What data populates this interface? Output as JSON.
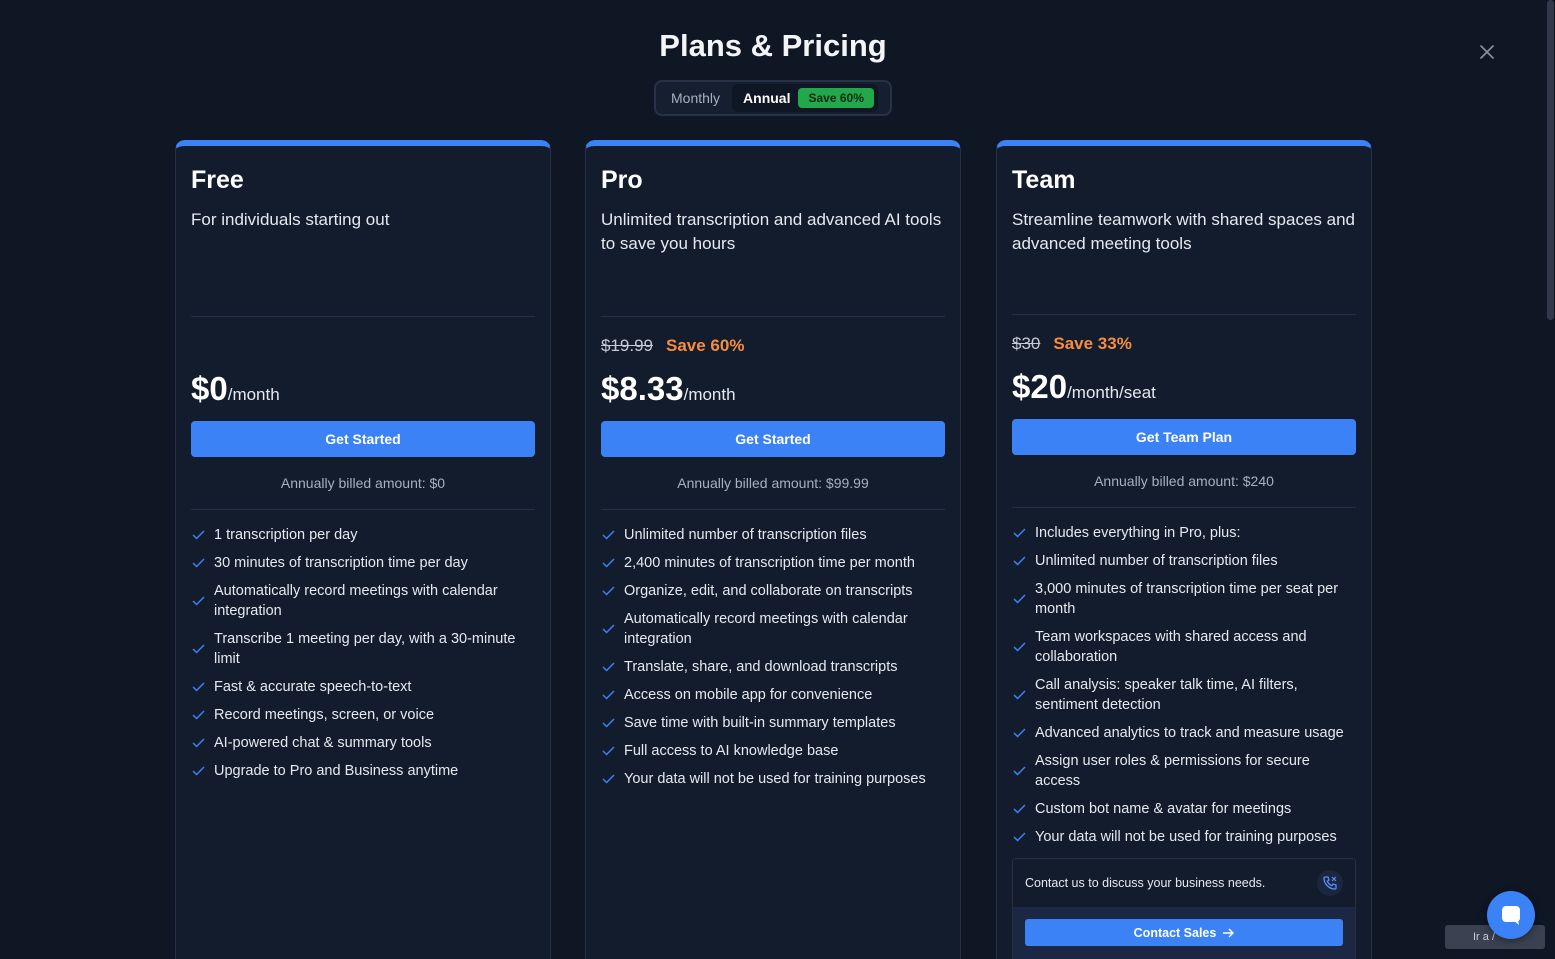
{
  "title": "Plans & Pricing",
  "billing_toggle": {
    "monthly": "Monthly",
    "annual": "Annual",
    "badge": "Save 60%",
    "selected": "Annual"
  },
  "colors": {
    "background": "#0f1624",
    "card": "#131c2c",
    "accent": "#3b82f6",
    "save_badge": "#22a84a",
    "save_text": "#f68d3e"
  },
  "plans": [
    {
      "name": "Free",
      "description": "For individuals starting out",
      "price": "$0",
      "unit": "/month",
      "cta": "Get Started",
      "billed": "Annually billed amount: $0",
      "features": [
        "1 transcription per day",
        "30 minutes of transcription time per day",
        "Automatically record meetings with calendar integration",
        "Transcribe 1 meeting per day, with a 30-minute limit",
        "Fast & accurate speech-to-text",
        "Record meetings, screen, or voice",
        "AI-powered chat & summary tools",
        "Upgrade to Pro and Business anytime"
      ]
    },
    {
      "name": "Pro",
      "description": "Unlimited transcription and advanced AI tools to save you hours",
      "old_price": "$19.99",
      "save": "Save 60%",
      "price": "$8.33",
      "unit": "/month",
      "cta": "Get Started",
      "billed": "Annually billed amount: $99.99",
      "features": [
        "Unlimited number of transcription files",
        "2,400 minutes of transcription time per month",
        "Organize, edit, and collaborate on transcripts",
        "Automatically record meetings with calendar integration",
        "Translate, share, and download transcripts",
        "Access on mobile app for convenience",
        "Save time with built-in summary templates",
        "Full access to AI knowledge base",
        "Your data will not be used for training purposes"
      ]
    },
    {
      "name": "Team",
      "description": "Streamline teamwork with shared spaces and advanced meeting tools",
      "old_price": "$30",
      "save": "Save 33%",
      "price": "$20",
      "unit": "/month/seat",
      "cta": "Get Team Plan",
      "billed": "Annually billed amount: $240",
      "features": [
        "Includes everything in Pro, plus:",
        "Unlimited number of transcription files",
        "3,000 minutes of transcription time per seat per month",
        "Team workspaces with shared access and collaboration",
        "Call analysis: speaker talk time, AI filters, sentiment detection",
        "Advanced analytics to track and measure usage",
        "Assign user roles & permissions for secure access",
        "Custom bot name & avatar for meetings",
        "Your data will not be used for training purposes"
      ],
      "contact_text": "Contact us to discuss your business needs.",
      "contact_cta": "Contact Sales"
    }
  ],
  "chat_widget": {
    "pill_text": "Ir a /"
  },
  "icons": [
    "close-icon",
    "check-icon",
    "phone-icon",
    "arrow-right-icon",
    "chat-icon"
  ]
}
